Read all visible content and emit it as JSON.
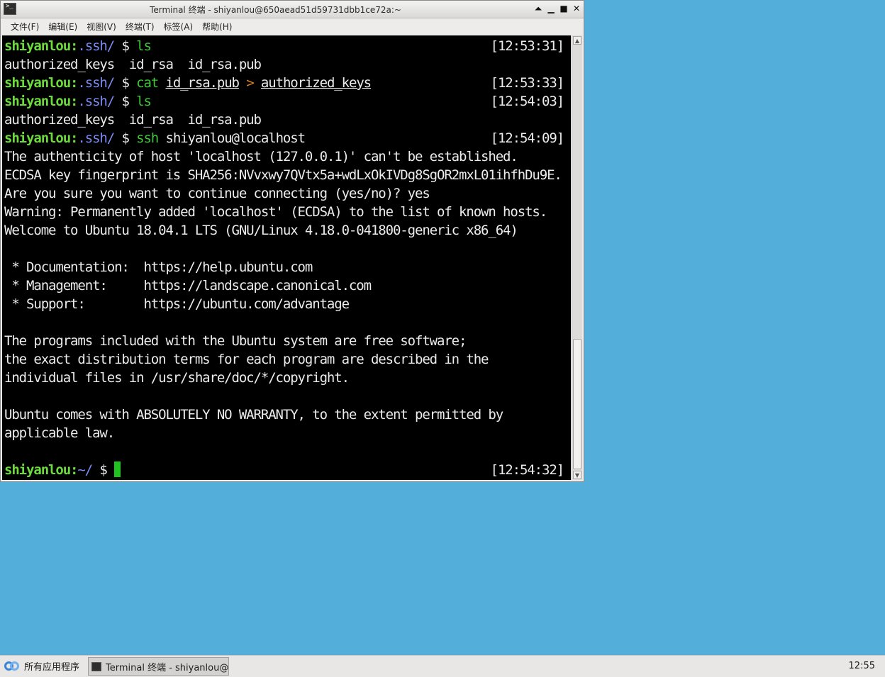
{
  "window": {
    "title": "Terminal 终端 - shiyanlou@650aead51d59731dbb1ce72a:~",
    "controls": {
      "shade": "⏶",
      "minimize": "▁",
      "maximize": "■",
      "close": "✕"
    }
  },
  "menu": {
    "items": [
      "文件(F)",
      "编辑(E)",
      "视图(V)",
      "终端(T)",
      "标签(A)",
      "帮助(H)"
    ]
  },
  "terminal": {
    "prompt_user": "shiyanlou:",
    "prompt_dir_ssh": ".ssh/",
    "prompt_dir_home": "~/",
    "prompt_symbol": "$",
    "cmd1": "ls",
    "ts1": "[12:53:31]",
    "out1": "authorized_keys  id_rsa  id_rsa.pub",
    "cmd2": "cat",
    "cmd2_arg1": "id_rsa.pub",
    "cmd2_redir": ">",
    "cmd2_arg2": "authorized_keys",
    "ts2": "[12:53:33]",
    "cmd3": "ls",
    "ts3": "[12:54:03]",
    "out3": "authorized_keys  id_rsa  id_rsa.pub",
    "cmd4": "ssh",
    "cmd4_arg": "shiyanlou@localhost",
    "ts4": "[12:54:09]",
    "ssh_lines": [
      "The authenticity of host 'localhost (127.0.0.1)' can't be established.",
      "ECDSA key fingerprint is SHA256:NVvxwy7QVtx5a+wdLxOkIVDg8SgOR2mxL01ihfhDu9E.",
      "Are you sure you want to continue connecting (yes/no)? yes",
      "Warning: Permanently added 'localhost' (ECDSA) to the list of known hosts.",
      "Welcome to Ubuntu 18.04.1 LTS (GNU/Linux 4.18.0-041800-generic x86_64)",
      "",
      " * Documentation:  https://help.ubuntu.com",
      " * Management:     https://landscape.canonical.com",
      " * Support:        https://ubuntu.com/advantage",
      "",
      "The programs included with the Ubuntu system are free software;",
      "the exact distribution terms for each program are described in the",
      "individual files in /usr/share/doc/*/copyright.",
      "",
      "Ubuntu comes with ABSOLUTELY NO WARRANTY, to the extent permitted by",
      "applicable law."
    ],
    "ts5": "[12:54:32]",
    "colors": {
      "background": "#000000",
      "user": "#6bdc3c",
      "dir": "#7a8cf5",
      "command": "#3fc73a",
      "redirect": "#d9821f",
      "cursor": "#1fc21f"
    }
  },
  "scrollbar": {
    "up": "▲",
    "down": "▼"
  },
  "taskbar": {
    "start_label": "所有应用程序",
    "task_label": "Terminal 终端 - shiyanlou@…",
    "clock": "12:55"
  },
  "desktop": {
    "background": "#53aed9"
  }
}
